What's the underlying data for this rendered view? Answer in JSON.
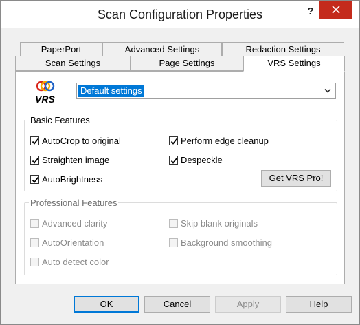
{
  "window": {
    "title": "Scan Configuration Properties",
    "help_label": "?"
  },
  "tabs": {
    "row1": [
      {
        "label": "PaperPort"
      },
      {
        "label": "Advanced Settings"
      },
      {
        "label": "Redaction Settings"
      }
    ],
    "row2": [
      {
        "label": "Scan Settings"
      },
      {
        "label": "Page Settings"
      },
      {
        "label": "VRS Settings",
        "active": true
      }
    ]
  },
  "vrs": {
    "logo_text": "VRS",
    "preset_value": "Default settings"
  },
  "basic": {
    "title": "Basic Features",
    "items": [
      {
        "label": "AutoCrop to original",
        "checked": true
      },
      {
        "label": "Perform edge cleanup",
        "checked": true
      },
      {
        "label": "Straighten image",
        "checked": true
      },
      {
        "label": "Despeckle",
        "checked": true
      },
      {
        "label": "AutoBrightness",
        "checked": true
      }
    ],
    "pro_button": "Get VRS Pro!"
  },
  "professional": {
    "title": "Professional Features",
    "items": [
      {
        "label": "Advanced clarity",
        "checked": false,
        "enabled": false
      },
      {
        "label": "Skip blank originals",
        "checked": false,
        "enabled": false
      },
      {
        "label": "AutoOrientation",
        "checked": false,
        "enabled": false
      },
      {
        "label": "Background smoothing",
        "checked": false,
        "enabled": false
      },
      {
        "label": "Auto detect color",
        "checked": false,
        "enabled": false
      }
    ]
  },
  "buttons": {
    "ok": "OK",
    "cancel": "Cancel",
    "apply": "Apply",
    "help": "Help"
  },
  "colors": {
    "accent": "#0078d7",
    "close": "#c42b1c"
  }
}
